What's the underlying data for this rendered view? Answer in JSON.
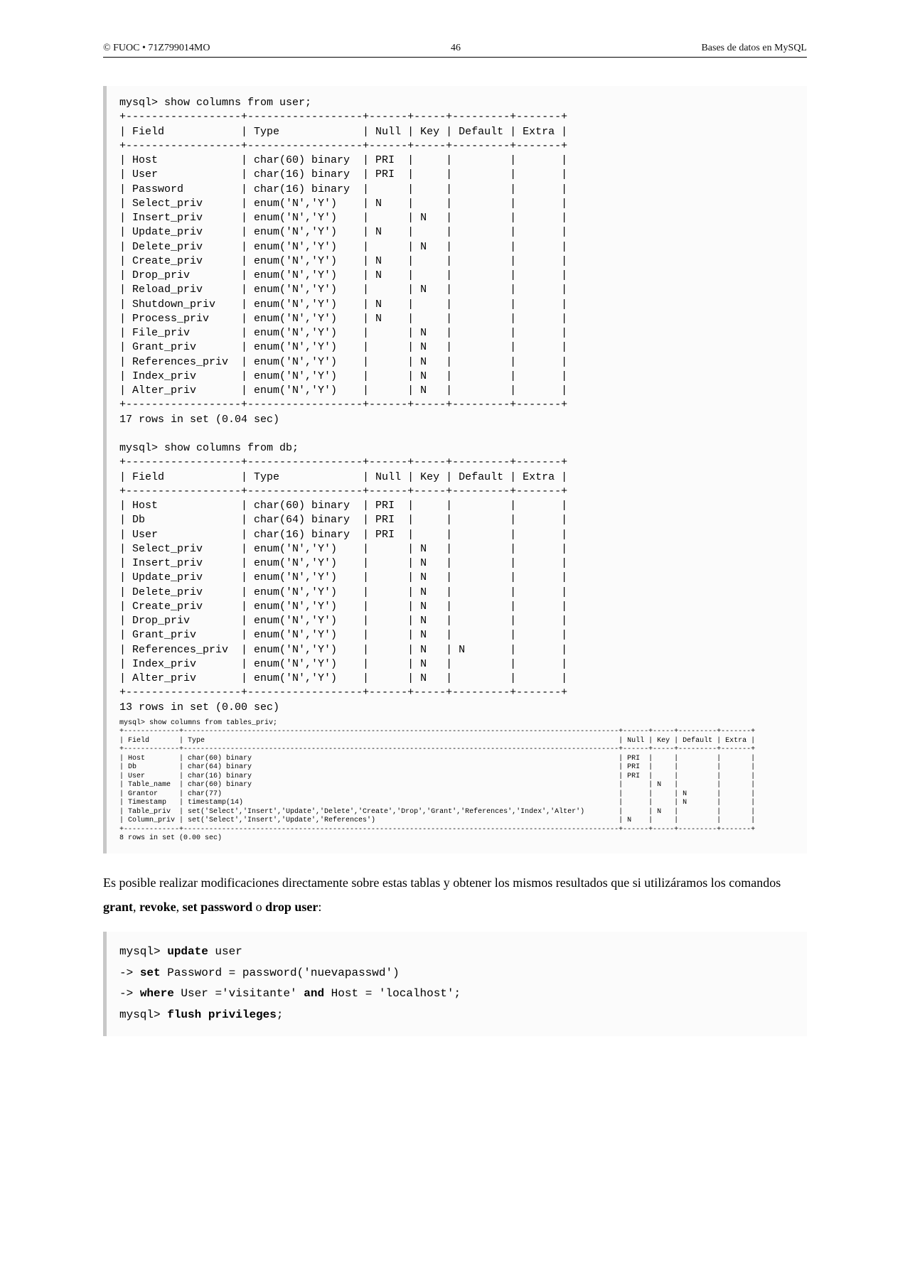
{
  "header": {
    "left": "© FUOC • 71Z799014MO",
    "center": "46",
    "right": "Bases de datos en MySQL"
  },
  "cmd_user": "mysql> show columns from user;",
  "table_user": {
    "head": [
      "Field",
      "Type",
      "Null",
      "Key",
      "Default",
      "Extra"
    ],
    "rows": [
      [
        "Host",
        "char(60) binary",
        "PRI",
        "",
        "",
        ""
      ],
      [
        "User",
        "char(16) binary",
        "PRI",
        "",
        "",
        ""
      ],
      [
        "Password",
        "char(16) binary",
        "",
        "",
        "",
        ""
      ],
      [
        "Select_priv",
        "enum('N','Y')",
        "N",
        "",
        "",
        ""
      ],
      [
        "Insert_priv",
        "enum('N','Y')",
        "",
        "N",
        "",
        ""
      ],
      [
        "Update_priv",
        "enum('N','Y')",
        "N",
        "",
        "",
        ""
      ],
      [
        "Delete_priv",
        "enum('N','Y')",
        "",
        "N",
        "",
        ""
      ],
      [
        "Create_priv",
        "enum('N','Y')",
        "N",
        "",
        "",
        ""
      ],
      [
        "Drop_priv",
        "enum('N','Y')",
        "N",
        "",
        "",
        ""
      ],
      [
        "Reload_priv",
        "enum('N','Y')",
        "",
        "N",
        "",
        ""
      ],
      [
        "Shutdown_priv",
        "enum('N','Y')",
        "N",
        "",
        "",
        ""
      ],
      [
        "Process_priv",
        "enum('N','Y')",
        "N",
        "",
        "",
        ""
      ],
      [
        "File_priv",
        "enum('N','Y')",
        "",
        "N",
        "",
        ""
      ],
      [
        "Grant_priv",
        "enum('N','Y')",
        "",
        "N",
        "",
        ""
      ],
      [
        "References_priv",
        "enum('N','Y')",
        "",
        "N",
        "",
        ""
      ],
      [
        "Index_priv",
        "enum('N','Y')",
        "",
        "N",
        "",
        ""
      ],
      [
        "Alter_priv",
        "enum('N','Y')",
        "",
        "N",
        "",
        ""
      ]
    ],
    "footer": "17 rows in set (0.04 sec)"
  },
  "cmd_db": "mysql> show columns from db;",
  "table_db": {
    "head": [
      "Field",
      "Type",
      "Null",
      "Key",
      "Default",
      "Extra"
    ],
    "rows": [
      [
        "Host",
        "char(60) binary",
        "PRI",
        "",
        "",
        ""
      ],
      [
        "Db",
        "char(64) binary",
        "PRI",
        "",
        "",
        ""
      ],
      [
        "User",
        "char(16) binary",
        "PRI",
        "",
        "",
        ""
      ],
      [
        "Select_priv",
        "enum('N','Y')",
        "",
        "N",
        "",
        ""
      ],
      [
        "Insert_priv",
        "enum('N','Y')",
        "",
        "N",
        "",
        ""
      ],
      [
        "Update_priv",
        "enum('N','Y')",
        "",
        "N",
        "",
        ""
      ],
      [
        "Delete_priv",
        "enum('N','Y')",
        "",
        "N",
        "",
        ""
      ],
      [
        "Create_priv",
        "enum('N','Y')",
        "",
        "N",
        "",
        ""
      ],
      [
        "Drop_priv",
        "enum('N','Y')",
        "",
        "N",
        "",
        ""
      ],
      [
        "Grant_priv",
        "enum('N','Y')",
        "",
        "N",
        "",
        ""
      ],
      [
        "References_priv",
        "enum('N','Y')",
        "",
        "N",
        "N",
        ""
      ],
      [
        "Index_priv",
        "enum('N','Y')",
        "",
        "N",
        "",
        ""
      ],
      [
        "Alter_priv",
        "enum('N','Y')",
        "",
        "N",
        "",
        ""
      ]
    ],
    "footer": "13 rows in set (0.00 sec)"
  },
  "cmd_tp": "mysql> show columns from tables_priv;",
  "table_tp": {
    "head": [
      "Field",
      "Type",
      "Null",
      "Key",
      "Default",
      "Extra"
    ],
    "rows": [
      [
        "Host",
        "char(60) binary",
        "PRI",
        "",
        "",
        ""
      ],
      [
        "Db",
        "char(64) binary",
        "PRI",
        "",
        "",
        ""
      ],
      [
        "User",
        "char(16) binary",
        "PRI",
        "",
        "",
        ""
      ],
      [
        "Table_name",
        "char(60) binary",
        "",
        "N",
        "",
        ""
      ],
      [
        "Grantor",
        "char(77)",
        "",
        "",
        "N",
        ""
      ],
      [
        "Timestamp",
        "timestamp(14)",
        "",
        "",
        "N",
        ""
      ],
      [
        "Table_priv",
        "set('Select','Insert','Update','Delete','Create','Drop','Grant','References','Index','Alter')",
        "",
        "N",
        "",
        ""
      ],
      [
        "Column_priv",
        "set('Select','Insert','Update','References')",
        "N",
        "",
        "",
        ""
      ]
    ],
    "footer": "8 rows in set (0.00 sec)"
  },
  "paragraph": {
    "p1": "Es posible realizar modificaciones directamente sobre estas tablas y obtener los mismos resultados que si utilizáramos los comandos ",
    "b1": "grant",
    "s1": ", ",
    "b2": "revoke",
    "s2": ", ",
    "b3": "set password",
    "s3": " o ",
    "b4": "drop user",
    "s4": ":"
  },
  "example": {
    "l1a": "mysql> ",
    "l1b": "update",
    "l1c": " user",
    "l2a": "-> ",
    "l2b": "set",
    "l2c": " Password = password('nuevapasswd')",
    "l3a": "-> ",
    "l3b": "where",
    "l3c": " User ='visitante' ",
    "l3d": "and",
    "l3e": " Host = 'localhost';",
    "l4a": "mysql> ",
    "l4b": "flush privileges",
    "l4c": ";"
  }
}
